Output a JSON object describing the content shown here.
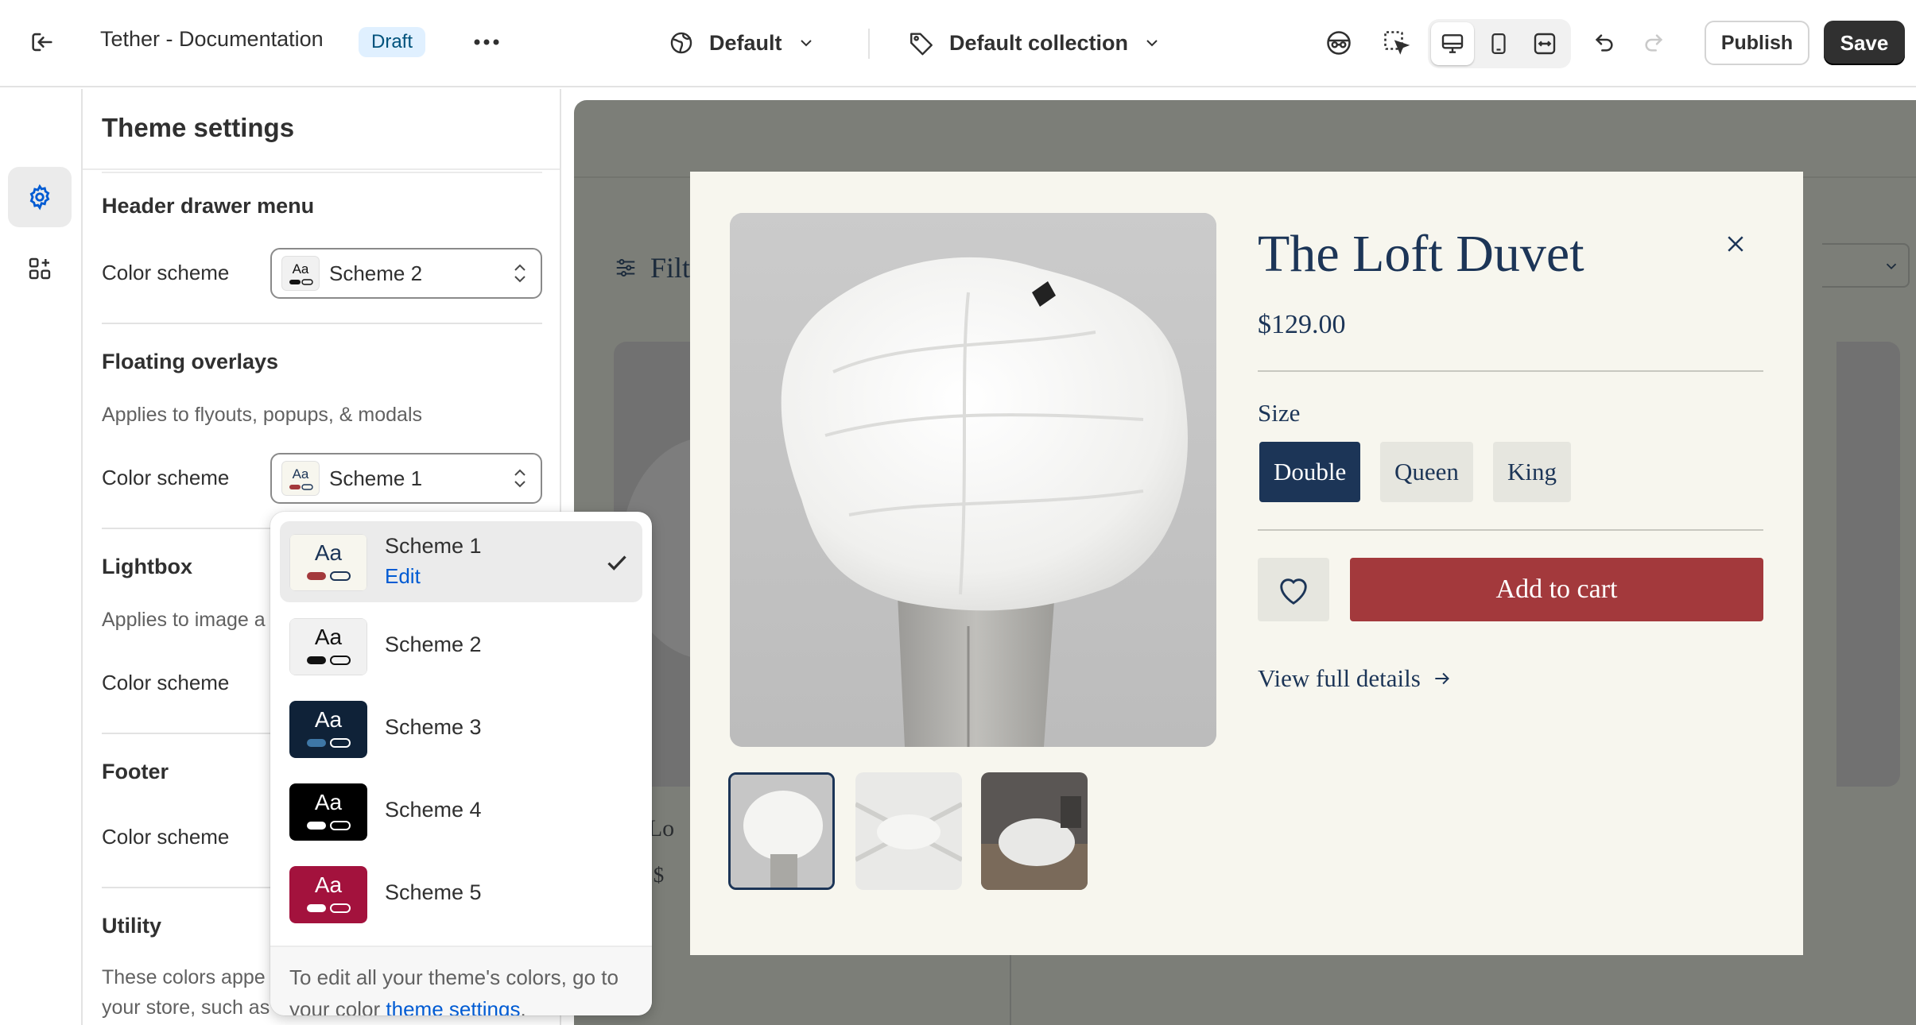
{
  "topbar": {
    "store_title": "Tether - Documentation",
    "status_badge": "Draft",
    "theme_selector": "Default",
    "collection_selector": "Default collection",
    "publish_label": "Publish",
    "save_label": "Save"
  },
  "rail": {
    "items": [
      {
        "icon": "sections-icon"
      },
      {
        "icon": "gear-icon",
        "active": true
      },
      {
        "icon": "apps-icon"
      }
    ]
  },
  "panel": {
    "title": "Theme settings",
    "sections": [
      {
        "title": "Header drawer menu",
        "label": "Color scheme",
        "value": "Scheme 2"
      },
      {
        "title": "Floating overlays",
        "description": "Applies to flyouts, popups, & modals",
        "label": "Color scheme",
        "value": "Scheme 1"
      },
      {
        "title": "Lightbox",
        "description": "Applies to image a",
        "label": "Color scheme"
      },
      {
        "title": "Footer",
        "label": "Color scheme"
      },
      {
        "title": "Utility",
        "description_line1": "These colors appe",
        "description_line2": "your store, such as"
      }
    ]
  },
  "dropdown": {
    "options": [
      {
        "name": "Scheme 1",
        "edit_label": "Edit",
        "selected": true,
        "bg": "#f7f6ee",
        "fg": "#1c3557",
        "pill": "#a3393c"
      },
      {
        "name": "Scheme 2",
        "bg": "#f1f1f1",
        "fg": "#111111",
        "pill": "#111111"
      },
      {
        "name": "Scheme 3",
        "bg": "#0f2238",
        "fg": "#ffffff",
        "pill": "#3e77a6"
      },
      {
        "name": "Scheme 4",
        "bg": "#000000",
        "fg": "#ffffff",
        "pill": "#ffffff"
      },
      {
        "name": "Scheme 5",
        "bg": "#a3123d",
        "fg": "#ffffff",
        "pill": "#ffffff"
      }
    ],
    "footer_text": "To edit all your theme's colors, go to your color ",
    "footer_link": "theme settings",
    "footer_end": "."
  },
  "preview": {
    "filter_label": "Filt",
    "card_title_fragment": "e Lo",
    "card_price_fragment": "m $"
  },
  "modal": {
    "product_title": "The Loft Duvet",
    "price": "$129.00",
    "size_label": "Size",
    "sizes": [
      "Double",
      "Queen",
      "King"
    ],
    "selected_size": "Double",
    "add_to_cart": "Add to cart",
    "view_details": "View full details"
  },
  "colors": {
    "accent_blue": "#005bd3",
    "brand_navy": "#1c3557",
    "cart_red": "#a3393c",
    "modal_bg": "#f7f6ee"
  }
}
